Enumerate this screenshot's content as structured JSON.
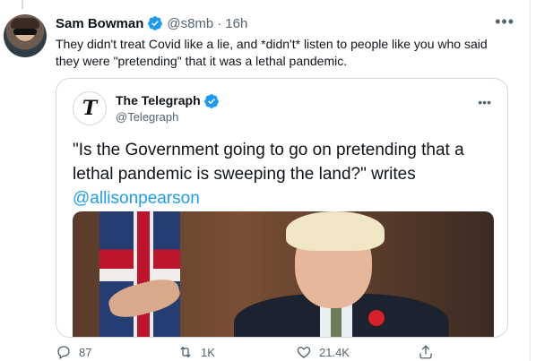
{
  "tweet": {
    "author_name": "Sam Bowman",
    "handle": "@s8mb",
    "separator": "·",
    "time": "16h",
    "more_icon": "more-icon",
    "text": "They didn't treat Covid like a lie, and *didn't* listen to people like you who said they were \"pretending\" that it was a lethal pandemic."
  },
  "quote": {
    "author_name": "The Telegraph",
    "handle": "@Telegraph",
    "logo_glyph": "T",
    "text": "\"Is the Government going to go on pretending that a lethal pandemic is sweeping the land?\" writes",
    "link": "@allisonpearson"
  },
  "actions": {
    "reply_count": "87",
    "retweet_count": "1K",
    "like_count": "21.4K"
  },
  "colors": {
    "verified": "#1d9bf0",
    "link": "#1d9bf0",
    "secondary_text": "#536471"
  }
}
